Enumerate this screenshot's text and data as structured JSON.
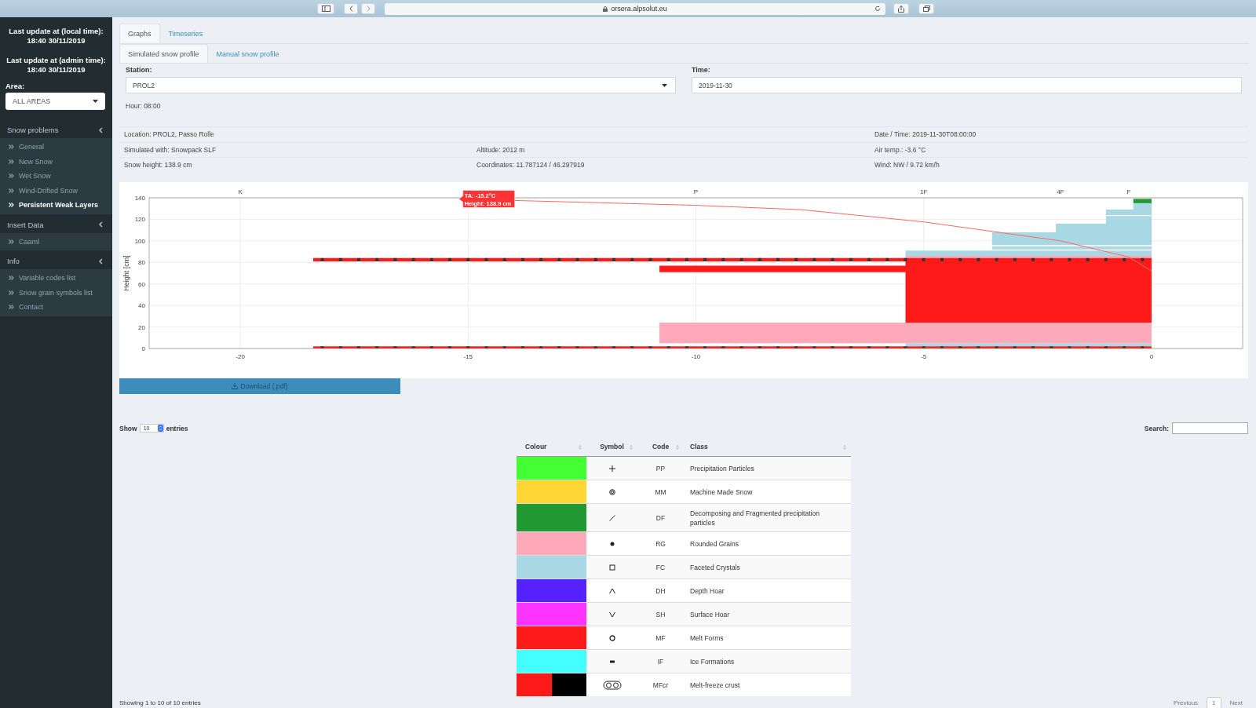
{
  "browser": {
    "url": "orsera.alpsolut.eu"
  },
  "sidebar": {
    "updates": [
      {
        "label": "Last update at (local time):",
        "value": "18:40 30/11/2019"
      },
      {
        "label": "Last update at (admin time):",
        "value": "18:40 30/11/2019"
      }
    ],
    "area": {
      "label": "Area:",
      "value": "ALL AREAS"
    },
    "sections": [
      {
        "title": "Snow problems",
        "items": [
          {
            "label": "General",
            "selected": false
          },
          {
            "label": "New Snow",
            "selected": false
          },
          {
            "label": "Wet Snow",
            "selected": false
          },
          {
            "label": "Wind-Drifted Snow",
            "selected": false
          },
          {
            "label": "Persistent Weak Layers",
            "selected": true
          }
        ]
      },
      {
        "title": "Insert Data",
        "items": [
          {
            "label": "Caaml",
            "selected": false
          }
        ]
      },
      {
        "title": "Info",
        "items": [
          {
            "label": "Variable codes list",
            "selected": false
          },
          {
            "label": "Snow grain symbols list",
            "selected": false
          },
          {
            "label": "Contact",
            "selected": false
          }
        ]
      }
    ]
  },
  "tabs": [
    {
      "label": "Graphs",
      "selected": true
    },
    {
      "label": "Timeseries",
      "selected": false
    }
  ],
  "subtabs": [
    {
      "label": "Simulated snow profile",
      "selected": true
    },
    {
      "label": "Manual snow profile",
      "selected": false
    }
  ],
  "station": {
    "label": "Station:",
    "value": "PROL2"
  },
  "time": {
    "label": "Time:",
    "value": "2019-11-30"
  },
  "hour": "Hour: 08:00",
  "info": [
    {
      "left": "Location: PROL2, Passo Rolle",
      "right": "Date / Time: 2019-11-30T08:00:00"
    },
    {
      "left": "Simulated with: Snowpack SLF",
      "middle": "Altitude: 2012 m",
      "right": "Air temp.: -3.6 °C"
    },
    {
      "left": "Snow height: 138.9 cm",
      "middle": "Coordinates: 11.787124 / 46.297919",
      "right": "Wind: NW / 9.72 km/h"
    }
  ],
  "profile": {
    "hardness_labels": [
      "K",
      "P",
      "1F",
      "4F",
      "F"
    ],
    "chart_data": {
      "type": "area",
      "orientation": "horizontal",
      "ylabel": "Height [cm]",
      "xlim": [
        -22,
        2
      ],
      "ylim": [
        0,
        140
      ],
      "grid": true,
      "xticks": [
        -20,
        -15,
        -10,
        -5,
        0
      ],
      "yticks": [
        0,
        20,
        40,
        60,
        80,
        100,
        120,
        140
      ],
      "series": [
        {
          "color": "#a8d8e3",
          "x": [
            2,
            5,
            null,
            86,
            91,
            null,
            92,
            95,
            null,
            96,
            108,
            108,
            116,
            116,
            123,
            null,
            124,
            129,
            129,
            135
          ],
          "values": [
            -5.4,
            -5.4,
            null,
            -5.4,
            -5.4,
            null,
            -3.5,
            -3.5,
            null,
            -3.5,
            -3.5,
            -2.1,
            -2.1,
            -1,
            -1,
            null,
            -1,
            -1,
            -0.4,
            -0.4
          ]
        },
        {
          "color": "#ffaabb",
          "x": [
            5,
            24,
            null,
            84,
            86
          ],
          "values": [
            -10.8,
            -10.8,
            null,
            -5.4,
            -5.4
          ]
        },
        {
          "color": "#ff1a1a",
          "x": [
            24,
            71,
            71,
            77,
            77,
            81
          ],
          "values": [
            -5.4,
            -5.4,
            -10.8,
            -10.8,
            -5.4,
            -5.4
          ]
        },
        {
          "color": "#229933",
          "x": [
            135,
            139
          ],
          "values": [
            -0.4,
            -0.4
          ]
        },
        {
          "color": "#ff1a1a",
          "x": [
            0,
            2,
            null,
            81,
            84
          ],
          "values": [
            -18.4,
            -18.4,
            null,
            -18.4,
            -18.4
          ]
        },
        {
          "type": "line",
          "color": "#ff6666",
          "x": [
            138.9,
            133,
            129,
            117.6,
            100,
            85,
            72
          ],
          "values": [
            -15.2,
            -10,
            -7.7,
            -5,
            -2,
            -0.5,
            0
          ]
        }
      ],
      "annotations": [
        "TA: -15.2°C",
        "Height: 138.9 cm"
      ]
    }
  },
  "download": "Download (.pdf)",
  "table": {
    "show": "Show",
    "length": "10",
    "entries": "entries",
    "search": "Search:",
    "columns": [
      "Colour",
      "Symbol",
      "Code",
      "Class"
    ],
    "rows": [
      {
        "color": "#44ff33",
        "kind": "plus",
        "code": "PP",
        "class": "Precipitation Particles"
      },
      {
        "color": "#ffd633",
        "kind": "target",
        "code": "MM",
        "class": "Machine Made Snow"
      },
      {
        "color": "#229933",
        "kind": "slash",
        "code": "DF",
        "class": "Decomposing and Fragmented precipitation particles"
      },
      {
        "color": "#ffaabb",
        "kind": "dot",
        "code": "RG",
        "class": "Rounded Grains"
      },
      {
        "color": "#a8d8e3",
        "kind": "square",
        "code": "FC",
        "class": "Faceted Crystals"
      },
      {
        "color": "#5522ff",
        "kind": "caret",
        "code": "DH",
        "class": "Depth Hoar"
      },
      {
        "color": "#ff33ff",
        "kind": "vee",
        "code": "SH",
        "class": "Surface Hoar"
      },
      {
        "color": "#ff1a1a",
        "kind": "ring",
        "code": "MF",
        "class": "Melt Forms"
      },
      {
        "color": "#44ffff",
        "kind": "bar",
        "code": "IF",
        "class": "Ice Formations"
      },
      {
        "color": "#ff1a1a",
        "kind": "rings",
        "code": "MFcr",
        "class": "Melt-freeze crust"
      }
    ],
    "footer": "Showing 1 to 10 of 10 entries",
    "pages": [
      {
        "label": "Previous",
        "selected": false
      },
      {
        "label": "1",
        "selected": true
      },
      {
        "label": "Next",
        "selected": false
      }
    ]
  }
}
